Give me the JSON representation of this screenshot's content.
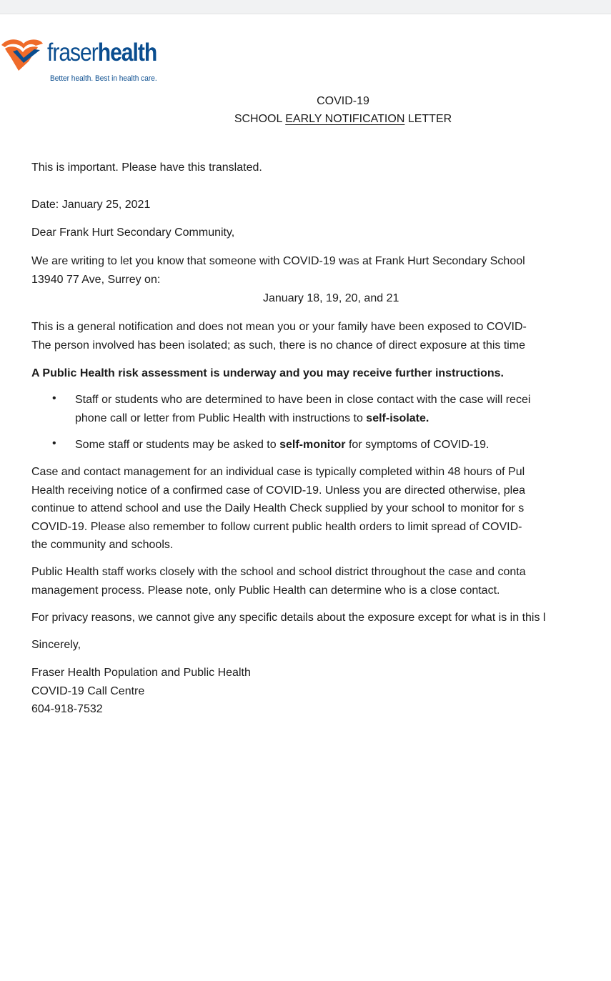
{
  "header": {
    "brand_first": "fraser",
    "brand_second": "health",
    "tagline": "Better health. Best in health care."
  },
  "letter": {
    "title_line1": "COVID-19",
    "title_line2_prefix": "SCHOOL ",
    "title_line2_underlined": "EARLY NOTIFICATION",
    "title_line2_suffix": " LETTER",
    "important": "This is important. Please have this translated.",
    "date": "Date: January 25, 2021",
    "salutation": "Dear Frank Hurt Secondary Community,",
    "intro_lines": [
      "We are writing to let you know that someone with COVID-19 was at Frank Hurt Secondary School",
      "13940 77 Ave, Surrey on:"
    ],
    "dates": "January 18, 19, 20, and 21",
    "general_lines": [
      "This is a general notification and does not mean you or your family have been exposed to COVID-",
      "The person involved has been isolated; as such, there is no chance of direct exposure at this time"
    ],
    "assessment": "A Public Health risk assessment is underway and you may receive further instructions.",
    "bullet1_line1": "Staff or students who are determined to have been in close contact with the case will recei",
    "bullet1_line2_prefix": "phone call or letter from Public Health with instructions to ",
    "bullet1_line2_bold": "self-isolate.",
    "bullet2_prefix": "Some staff or students may be asked to ",
    "bullet2_bold": "self-monitor",
    "bullet2_suffix": " for symptoms of COVID-19.",
    "bullet_symbol": "•",
    "case_lines": [
      "Case and contact management for an individual case is typically completed within 48 hours of Pul",
      "Health receiving notice of a confirmed case of COVID-19. Unless you are directed otherwise, plea",
      "continue to attend school and use the Daily Health Check supplied by your school to monitor for s",
      "COVID-19. Please also remember to follow current public health orders to limit spread of COVID-",
      "the community and schools."
    ],
    "staff_lines": [
      "Public Health staff works closely with the school and school district throughout the case and conta",
      "management process. Please note, only Public Health can determine who is a close contact."
    ],
    "privacy": "For privacy reasons, we cannot give any specific details about the exposure except for what is in this l",
    "closing": "Sincerely,",
    "signature_lines": [
      "Fraser Health Population and Public Health",
      "COVID-19 Call Centre",
      "604-918-7532"
    ]
  },
  "colors": {
    "brand_blue": "#0a4d8f",
    "brand_orange": "#ef6b2a"
  }
}
